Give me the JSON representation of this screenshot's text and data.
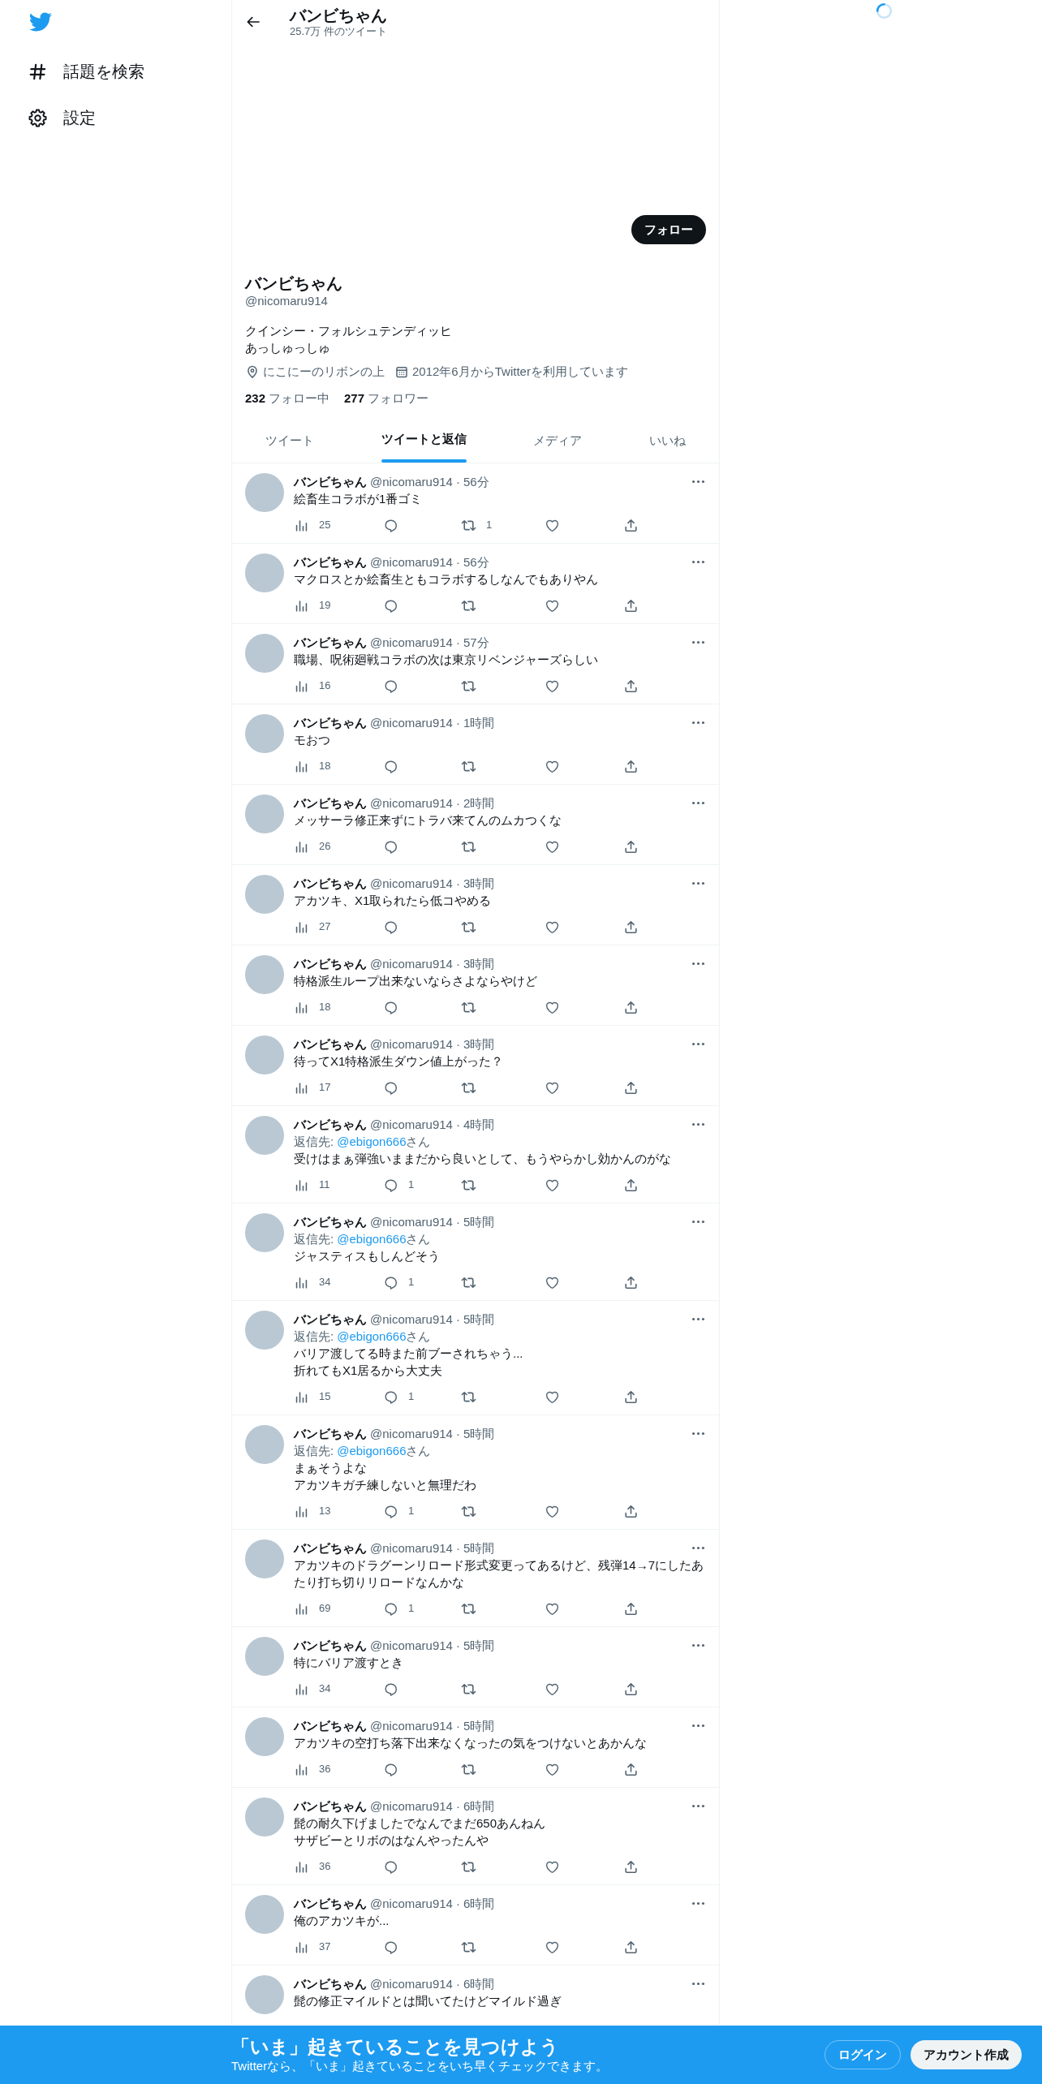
{
  "sidebar": {
    "items": [
      {
        "kind": "explore",
        "label": "話題を検索"
      },
      {
        "kind": "settings",
        "label": "設定"
      }
    ]
  },
  "header": {
    "title": "バンビちゃん",
    "subtitle": "25.7万 件のツイート"
  },
  "profile": {
    "follow_button": "フォロー",
    "name": "バンビちゃん",
    "handle": "@nicomaru914",
    "bio": [
      "クインシー・フォルシュテンディッヒ",
      "あっしゅっしゅ"
    ],
    "location": "にこにーのリボンの上",
    "joined": "2012年6月からTwitterを利用しています",
    "following": {
      "count": "232",
      "label": "フォロー中"
    },
    "followers": {
      "count": "277",
      "label": "フォロワー"
    }
  },
  "tabs": [
    {
      "label": "ツイート",
      "selected": false
    },
    {
      "label": "ツイートと返信",
      "selected": true
    },
    {
      "label": "メディア",
      "selected": false
    },
    {
      "label": "いいね",
      "selected": false
    }
  ],
  "tweets": [
    {
      "name": "バンビちゃん",
      "handle": "@nicomaru914",
      "dot": "·",
      "time": "56分",
      "text": [
        "絵畜生コラボが1番ゴミ"
      ],
      "actions": {
        "views": "25",
        "retweets": "1"
      }
    },
    {
      "name": "バンビちゃん",
      "handle": "@nicomaru914",
      "dot": "·",
      "time": "56分",
      "text": [
        "マクロスとか絵畜生ともコラボするしなんでもありやん"
      ],
      "actions": {
        "views": "19"
      }
    },
    {
      "name": "バンビちゃん",
      "handle": "@nicomaru914",
      "dot": "·",
      "time": "57分",
      "text": [
        "職場、呪術廻戦コラボの次は東京リベンジャーズらしい"
      ],
      "actions": {
        "views": "16"
      }
    },
    {
      "name": "バンビちゃん",
      "handle": "@nicomaru914",
      "dot": "·",
      "time": "1時間",
      "text": [
        "モおつ"
      ],
      "actions": {
        "views": "18"
      }
    },
    {
      "name": "バンビちゃん",
      "handle": "@nicomaru914",
      "dot": "·",
      "time": "2時間",
      "text": [
        "メッサーラ修正来ずにトラバ来てんのムカつくな"
      ],
      "actions": {
        "views": "26"
      }
    },
    {
      "name": "バンビちゃん",
      "handle": "@nicomaru914",
      "dot": "·",
      "time": "3時間",
      "text": [
        "アカツキ、X1取られたら低コやめる"
      ],
      "actions": {
        "views": "27"
      }
    },
    {
      "name": "バンビちゃん",
      "handle": "@nicomaru914",
      "dot": "·",
      "time": "3時間",
      "text": [
        "特格派生ループ出来ないならさよならやけど"
      ],
      "actions": {
        "views": "18"
      }
    },
    {
      "name": "バンビちゃん",
      "handle": "@nicomaru914",
      "dot": "·",
      "time": "3時間",
      "text": [
        "待ってX1特格派生ダウン値上がった？"
      ],
      "actions": {
        "views": "17"
      }
    },
    {
      "name": "バンビちゃん",
      "handle": "@nicomaru914",
      "dot": "·",
      "time": "4時間",
      "reply_to": {
        "prefix": "返信先:",
        "handle": "@ebigon666",
        "suffix": "さん"
      },
      "text": [
        "受けはまぁ弾強いままだから良いとして、もうやらかし効かんのがな"
      ],
      "actions": {
        "views": "11",
        "replies": "1"
      }
    },
    {
      "name": "バンビちゃん",
      "handle": "@nicomaru914",
      "dot": "·",
      "time": "5時間",
      "reply_to": {
        "prefix": "返信先:",
        "handle": "@ebigon666",
        "suffix": "さん"
      },
      "text": [
        "ジャスティスもしんどそう"
      ],
      "actions": {
        "views": "34",
        "replies": "1"
      }
    },
    {
      "name": "バンビちゃん",
      "handle": "@nicomaru914",
      "dot": "·",
      "time": "5時間",
      "reply_to": {
        "prefix": "返信先:",
        "handle": "@ebigon666",
        "suffix": "さん"
      },
      "text": [
        "バリア渡してる時また前ブーされちゃう...",
        "折れてもX1居るから大丈夫"
      ],
      "actions": {
        "views": "15",
        "replies": "1"
      }
    },
    {
      "name": "バンビちゃん",
      "handle": "@nicomaru914",
      "dot": "·",
      "time": "5時間",
      "reply_to": {
        "prefix": "返信先:",
        "handle": "@ebigon666",
        "suffix": "さん"
      },
      "text": [
        "まぁそうよな",
        "アカツキガチ練しないと無理だわ"
      ],
      "actions": {
        "views": "13",
        "replies": "1"
      }
    },
    {
      "name": "バンビちゃん",
      "handle": "@nicomaru914",
      "dot": "·",
      "time": "5時間",
      "text": [
        "アカツキのドラグーンリロード形式変更ってあるけど、残弾14→7にしたあたり打ち切りリロードなんかな"
      ],
      "actions": {
        "views": "69",
        "replies": "1"
      }
    },
    {
      "name": "バンビちゃん",
      "handle": "@nicomaru914",
      "dot": "·",
      "time": "5時間",
      "text": [
        "特にバリア渡すとき"
      ],
      "actions": {
        "views": "34"
      }
    },
    {
      "name": "バンビちゃん",
      "handle": "@nicomaru914",
      "dot": "·",
      "time": "5時間",
      "text": [
        "アカツキの空打ち落下出来なくなったの気をつけないとあかんな"
      ],
      "actions": {
        "views": "36"
      }
    },
    {
      "name": "バンビちゃん",
      "handle": "@nicomaru914",
      "dot": "·",
      "time": "6時間",
      "text": [
        "髭の耐久下げましたでなんでまだ650あんねん",
        "サザビーとリボのはなんやったんや"
      ],
      "actions": {
        "views": "36"
      }
    },
    {
      "name": "バンビちゃん",
      "handle": "@nicomaru914",
      "dot": "·",
      "time": "6時間",
      "text": [
        "俺のアカツキが..."
      ],
      "actions": {
        "views": "37"
      }
    },
    {
      "name": "バンビちゃん",
      "handle": "@nicomaru914",
      "dot": "·",
      "time": "6時間",
      "text": [
        "髭の修正マイルドとは聞いてたけどマイルド過ぎ"
      ]
    }
  ],
  "signup_banner": {
    "title": "「いま」起きていることを見つけよう",
    "subtitle": "Twitterなら、「いま」起きていることをいち早くチェックできます。",
    "login_button": "ログイン",
    "signup_button": "アカウント作成"
  }
}
